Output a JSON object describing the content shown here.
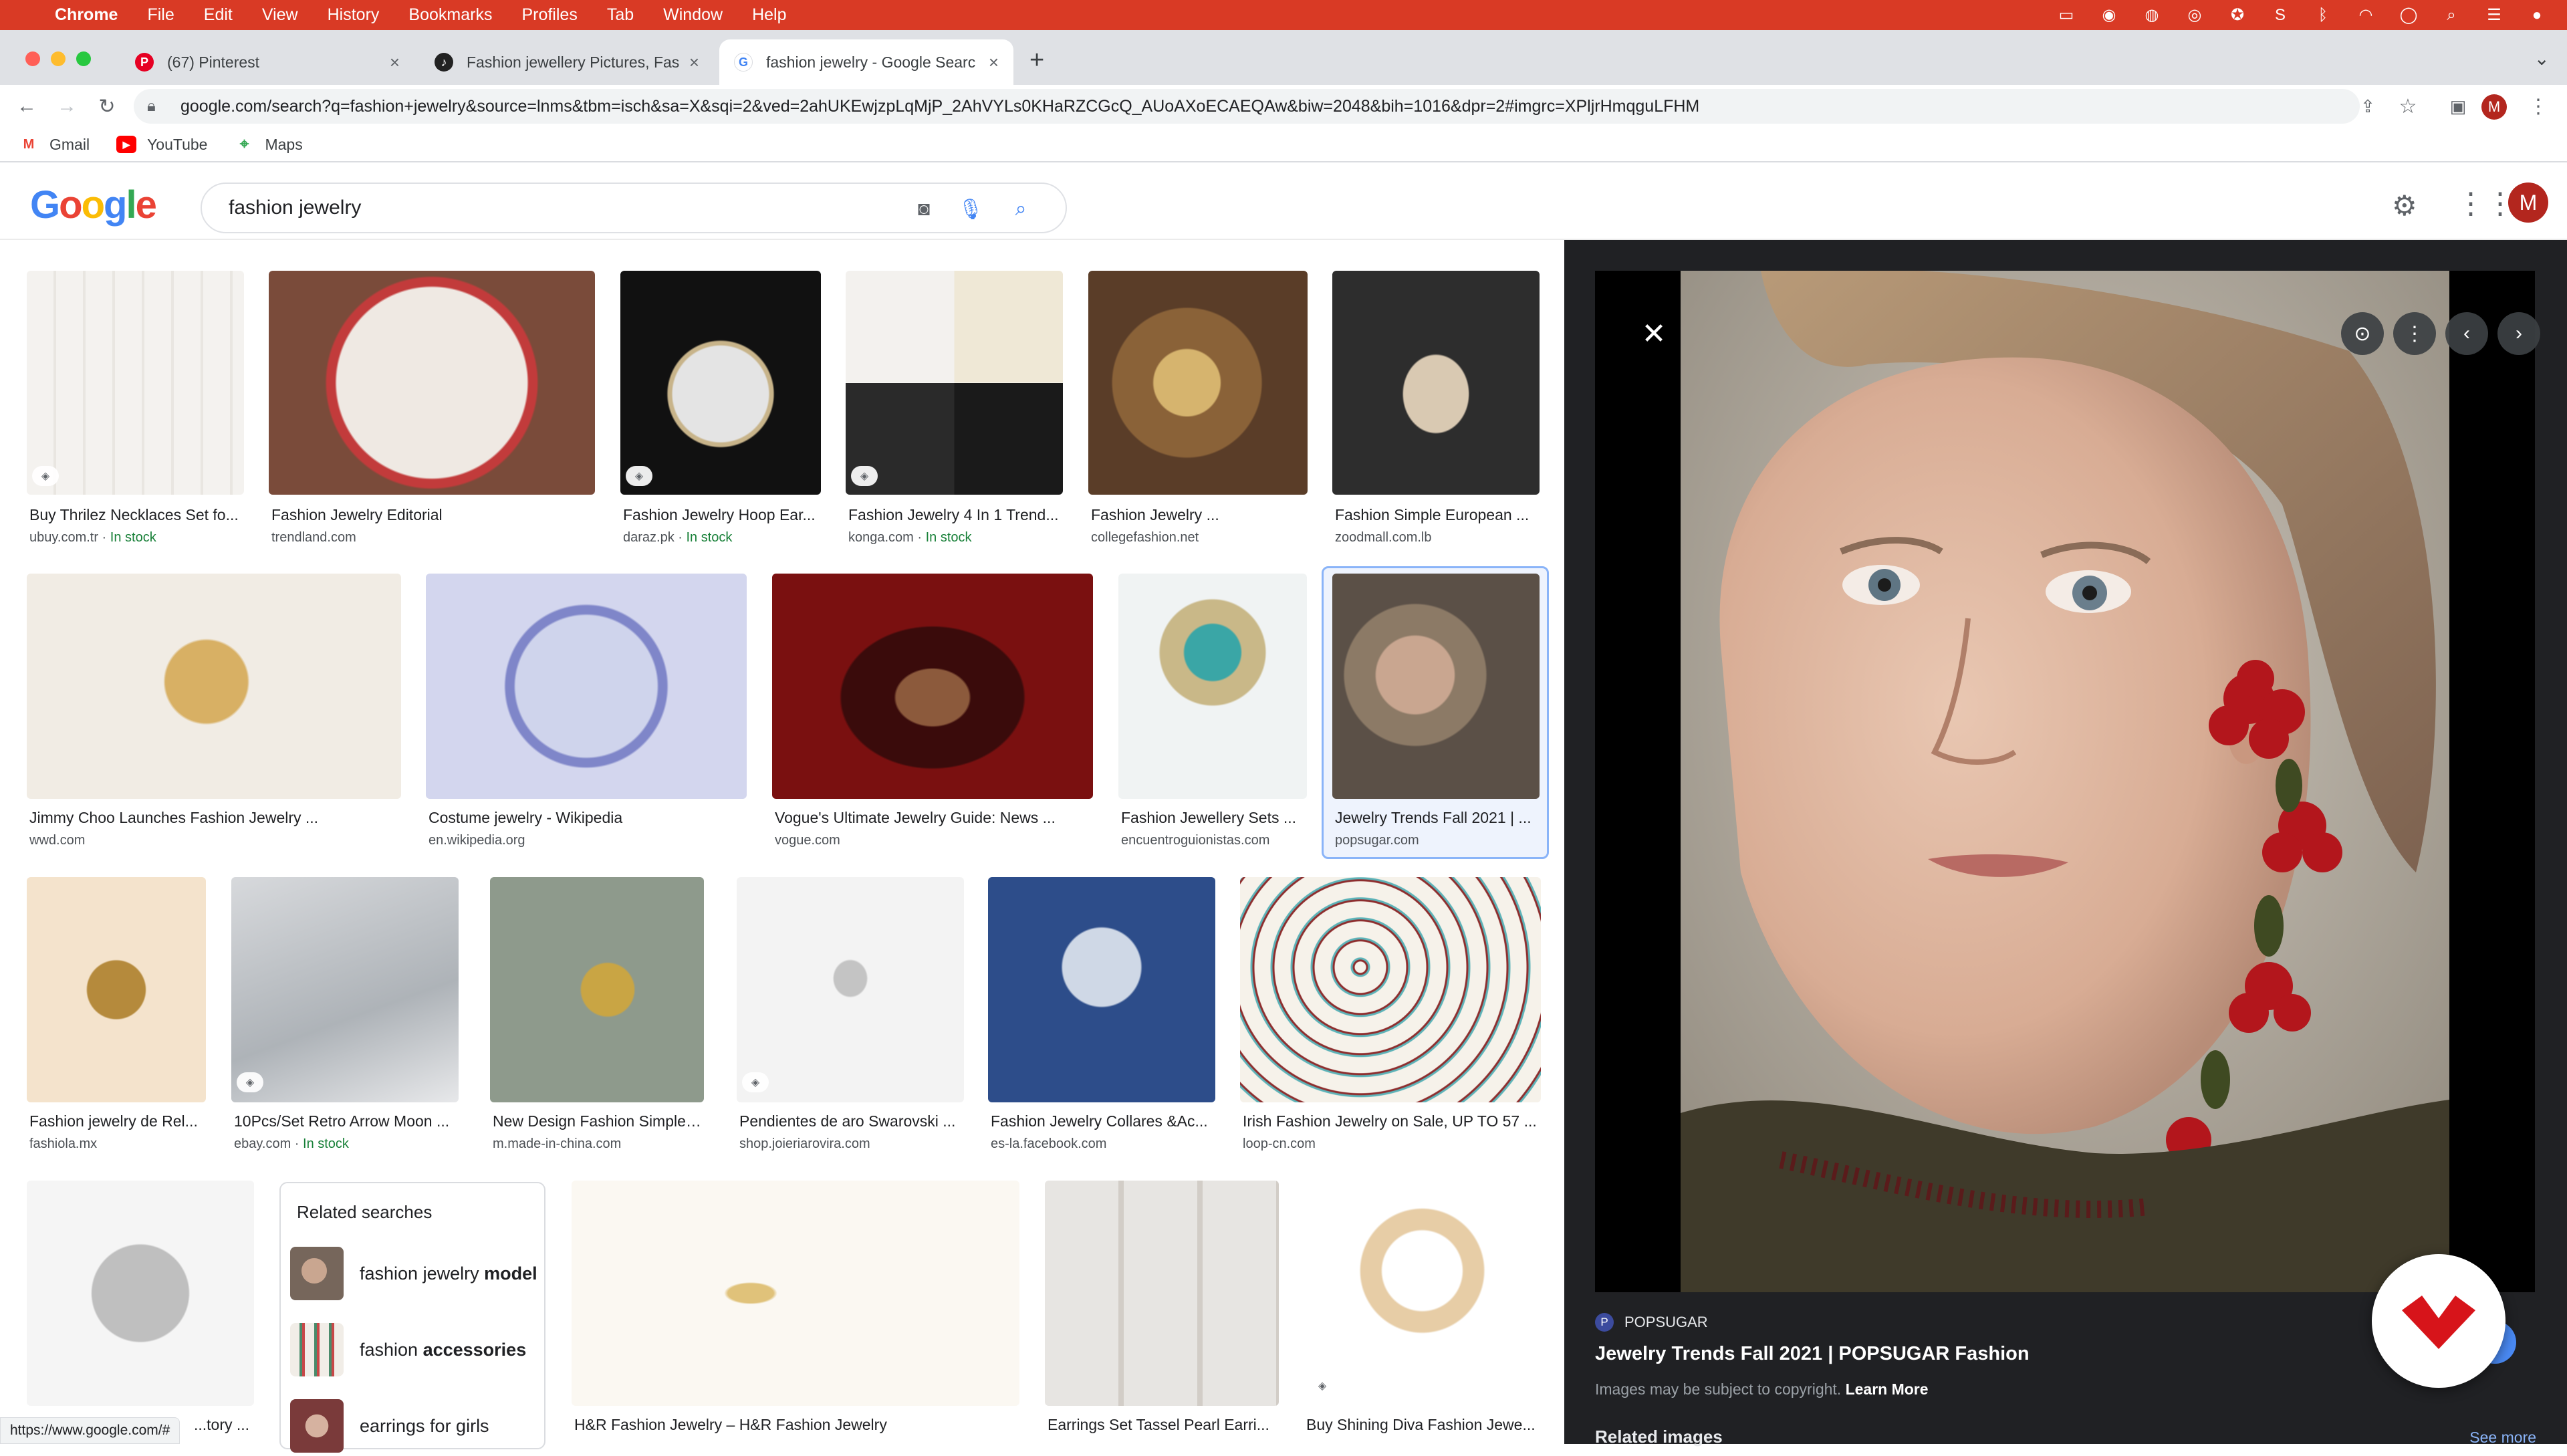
{
  "menubar": {
    "apple": "",
    "items": [
      "Chrome",
      "File",
      "Edit",
      "View",
      "History",
      "Bookmarks",
      "Profiles",
      "Tab",
      "Window",
      "Help"
    ]
  },
  "tabs": [
    {
      "title": "(67) Pinterest",
      "close": "×"
    },
    {
      "title": "Fashion jewellery Pictures, Fas",
      "close": "×"
    },
    {
      "title": "fashion jewelry - Google Searc",
      "close": "×"
    }
  ],
  "new_tab": "+",
  "omnibox": {
    "url": "google.com/search?q=fashion+jewelry&source=lnms&tbm=isch&sa=X&sqi=2&ved=2ahUKEwjzpLqMjP_2AhVYLs0KHaRZCGcQ_AUoAXoECAEQAw&biw=2048&bih=1016&dpr=2#imgrc=XPljrHmqguLFHM"
  },
  "bookmarks": [
    {
      "label": "Gmail",
      "icon": "gmail-icon"
    },
    {
      "label": "YouTube",
      "icon": "youtube-icon"
    },
    {
      "label": "Maps",
      "icon": "maps-icon"
    }
  ],
  "google": {
    "logo": "Google",
    "query": "fashion jewelry",
    "avatar": "M"
  },
  "results": [
    {
      "title": "Buy Thrilez Necklaces Set fo...",
      "source": "ubuy.com.tr",
      "stock": "In stock"
    },
    {
      "title": "Fashion Jewelry Editorial",
      "source": "trendland.com",
      "stock": ""
    },
    {
      "title": "Fashion Jewelry Hoop Ear...",
      "source": "daraz.pk",
      "stock": "In stock"
    },
    {
      "title": "Fashion Jewelry 4 In 1 Trend...",
      "source": "konga.com",
      "stock": "In stock"
    },
    {
      "title": "Fashion Jewelry ...",
      "source": "collegefashion.net",
      "stock": ""
    },
    {
      "title": "Fashion Simple European ...",
      "source": "zoodmall.com.lb",
      "stock": ""
    },
    {
      "title": "Jimmy Choo Launches Fashion Jewelry ...",
      "source": "wwd.com",
      "stock": ""
    },
    {
      "title": "Costume jewelry - Wikipedia",
      "source": "en.wikipedia.org",
      "stock": ""
    },
    {
      "title": "Vogue's Ultimate Jewelry Guide: News ...",
      "source": "vogue.com",
      "stock": ""
    },
    {
      "title": "Fashion Jewellery Sets ...",
      "source": "encuentroguionistas.com",
      "stock": ""
    },
    {
      "title": "Jewelry Trends Fall 2021 | ...",
      "source": "popsugar.com",
      "stock": ""
    },
    {
      "title": "Fashion jewelry de Rel...",
      "source": "fashiola.mx",
      "stock": ""
    },
    {
      "title": "10Pcs/Set Retro Arrow Moon ...",
      "source": "ebay.com",
      "stock": "In stock"
    },
    {
      "title": "New Design Fashion Simple E...",
      "source": "m.made-in-china.com",
      "stock": ""
    },
    {
      "title": "Pendientes de aro Swarovski ...",
      "source": "shop.joieriarovira.com",
      "stock": ""
    },
    {
      "title": "Fashion Jewelry Collares &Ac...",
      "source": "es-la.facebook.com",
      "stock": ""
    },
    {
      "title": "Irish Fashion Jewelry on Sale, UP TO 57 ...",
      "source": "loop-cn.com",
      "stock": ""
    },
    {
      "title": "...tory ...",
      "source": "",
      "stock": ""
    },
    {
      "title": "H&R Fashion Jewelry – H&R Fashion Jewelry",
      "source": "",
      "stock": ""
    },
    {
      "title": "Earrings Set Tassel Pearl Earri...",
      "source": "",
      "stock": ""
    },
    {
      "title": "Buy Shining Diva Fashion Jewe...",
      "source": "",
      "stock": ""
    }
  ],
  "related": {
    "heading": "Related searches",
    "items": [
      {
        "plain": "fashion jewelry ",
        "bold": "model"
      },
      {
        "plain": "fashion ",
        "bold": "accessories"
      },
      {
        "plain": "earrings for girls",
        "bold": ""
      }
    ]
  },
  "preview": {
    "site": "POPSUGAR",
    "title": "Jewelry Trends Fall 2021 | POPSUGAR Fashion",
    "copyright": "Images may be subject to copyright.",
    "learn_more": "Learn More",
    "related_heading": "Related images",
    "see_more": "See more"
  },
  "status_url": "https://www.google.com/#",
  "colors": {
    "menubar": "#d93a25",
    "link_blue": "#1a73e8",
    "in_stock": "#188038",
    "panel": "#202124"
  }
}
